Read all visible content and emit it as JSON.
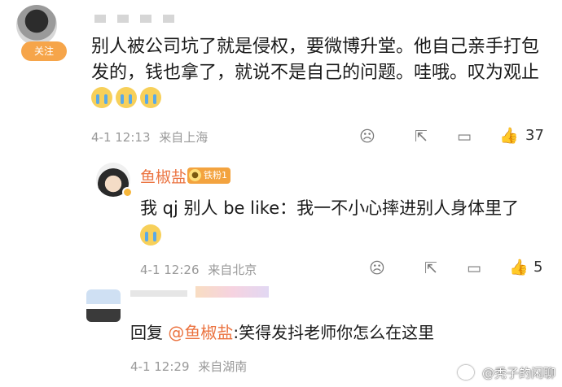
{
  "comment1": {
    "follow_label": "关注",
    "text": "别人被公司坑了就是侵权，要微博升堂。他自己亲手打包发的，钱也拿了，就说不是自己的问题。哇哦。叹为观止",
    "time": "4-1 12:13",
    "location": "来自上海",
    "likes": "37"
  },
  "reply1": {
    "name": "鱼椒盐",
    "fan_badge": "铁粉1",
    "text": "我 qj 别人 be like：我一不小心摔进别人身体里了",
    "time": "4-1 12:26",
    "location": "来自北京",
    "likes": "5"
  },
  "reply2": {
    "prefix": "回复",
    "mention": "@鱼椒盐",
    "text": ":笑得发抖老师你怎么在这里",
    "time": "4-1 12:29",
    "location": "来自湖南"
  },
  "watermark": "@秃子的闲聊",
  "icons": {
    "dislike": "sad-face-icon",
    "share": "share-icon",
    "comment": "comment-icon",
    "like": "thumb-up-icon"
  },
  "colors": {
    "accent": "#eb7340",
    "like": "#f07a2a",
    "follow": "#f6a54a"
  }
}
